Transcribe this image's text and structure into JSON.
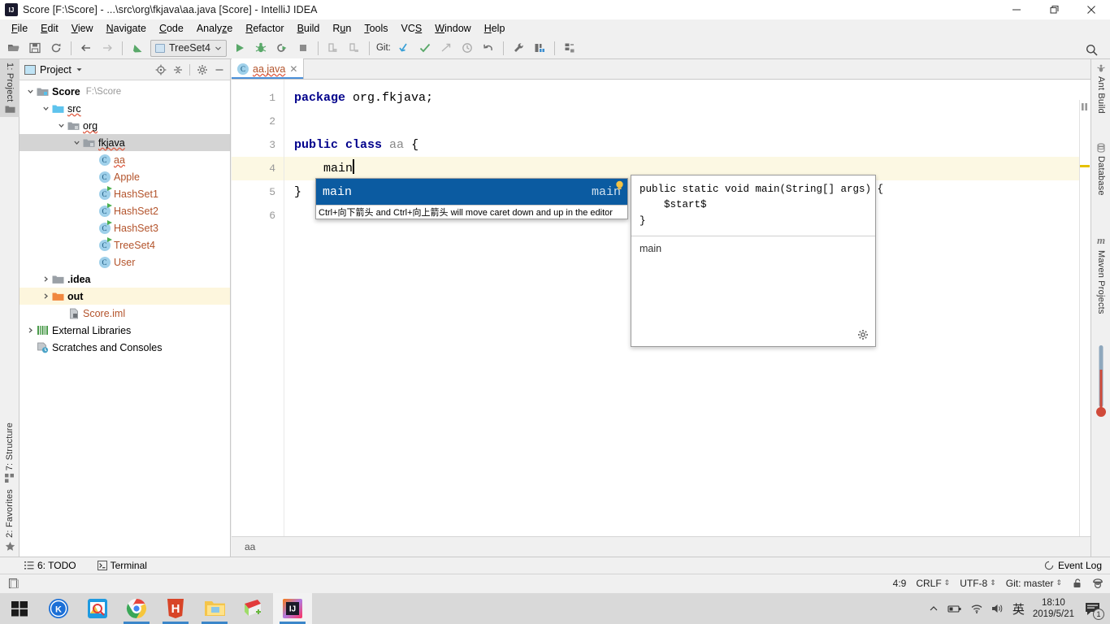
{
  "window": {
    "title": "Score [F:\\Score] - ...\\src\\org\\fkjava\\aa.java [Score] - IntelliJ IDEA",
    "app_icon": "intellij-idea-icon",
    "minimize": "—",
    "restore": "❐",
    "close": "✕"
  },
  "menubar": {
    "items": [
      {
        "label": "File"
      },
      {
        "label": "Edit"
      },
      {
        "label": "View"
      },
      {
        "label": "Navigate"
      },
      {
        "label": "Code"
      },
      {
        "label": "Analyze"
      },
      {
        "label": "Refactor"
      },
      {
        "label": "Build"
      },
      {
        "label": "Run"
      },
      {
        "label": "Tools"
      },
      {
        "label": "VCS"
      },
      {
        "label": "Window"
      },
      {
        "label": "Help"
      }
    ]
  },
  "toolbar": {
    "run_config": "TreeSet4",
    "git_label": "Git:",
    "icons": [
      "open-folder-icon",
      "save-all-icon",
      "sync-icon",
      "back-arrow-icon",
      "forward-arrow-icon",
      "compile-icon",
      "run-icon",
      "debug-icon",
      "run-coverage-icon",
      "stop-icon",
      "build-project-icon",
      "build-module-icon",
      "update-project-icon",
      "commit-icon",
      "push-icon",
      "history-icon",
      "undo-icon",
      "settings-wrench-icon",
      "structure-icon",
      "sdk-icon",
      "search-everywhere-icon"
    ]
  },
  "left_strip": {
    "top_buttons": [
      {
        "label": "1: Project",
        "icon": "project-folder-icon",
        "active": true
      }
    ],
    "bottom_buttons": [
      {
        "label": "7: Structure",
        "icon": "structure-icon"
      },
      {
        "label": "2: Favorites",
        "icon": "star-icon"
      }
    ]
  },
  "right_strip": {
    "buttons": [
      {
        "label": "Ant Build",
        "icon": "ant-icon"
      },
      {
        "label": "Database",
        "icon": "database-icon"
      },
      {
        "label": "Maven Projects",
        "icon": "maven-icon"
      }
    ]
  },
  "project_panel": {
    "title": "Project",
    "dropdown_icon": "chevron-down-icon",
    "header_icons": [
      "locate-icon",
      "collapse-all-icon",
      "gear-icon",
      "hide-icon"
    ],
    "tree": [
      {
        "depth": 0,
        "arrow": "down",
        "icon": "module-folder-icon",
        "label": "Score",
        "sub": "F:\\Score",
        "bold": true,
        "style": "plain",
        "row": "normal"
      },
      {
        "depth": 1,
        "arrow": "down",
        "icon": "source-folder-icon",
        "label": "src",
        "sub": "",
        "bold": false,
        "style": "wavy",
        "row": "normal"
      },
      {
        "depth": 2,
        "arrow": "down",
        "icon": "package-icon",
        "label": "org",
        "sub": "",
        "bold": false,
        "style": "wavy",
        "row": "normal"
      },
      {
        "depth": 3,
        "arrow": "down",
        "icon": "package-icon",
        "label": "fkjava",
        "sub": "",
        "bold": false,
        "style": "wavy",
        "row": "sel-gray"
      },
      {
        "depth": 4,
        "arrow": "none",
        "icon": "class-icon",
        "label": "aa",
        "sub": "",
        "bold": false,
        "style": "class-wavy",
        "row": "normal"
      },
      {
        "depth": 4,
        "arrow": "none",
        "icon": "class-icon",
        "label": "Apple",
        "sub": "",
        "bold": false,
        "style": "class",
        "row": "normal"
      },
      {
        "depth": 4,
        "arrow": "none",
        "icon": "runnable-class-icon",
        "label": "HashSet1",
        "sub": "",
        "bold": false,
        "style": "class",
        "row": "normal"
      },
      {
        "depth": 4,
        "arrow": "none",
        "icon": "runnable-class-icon",
        "label": "HashSet2",
        "sub": "",
        "bold": false,
        "style": "class",
        "row": "normal"
      },
      {
        "depth": 4,
        "arrow": "none",
        "icon": "runnable-class-icon",
        "label": "HashSet3",
        "sub": "",
        "bold": false,
        "style": "class",
        "row": "normal"
      },
      {
        "depth": 4,
        "arrow": "none",
        "icon": "runnable-class-icon",
        "label": "TreeSet4",
        "sub": "",
        "bold": false,
        "style": "class",
        "row": "normal"
      },
      {
        "depth": 4,
        "arrow": "none",
        "icon": "class-icon",
        "label": "User",
        "sub": "",
        "bold": false,
        "style": "class",
        "row": "normal"
      },
      {
        "depth": 1,
        "arrow": "right",
        "icon": "gray-folder-icon",
        "label": ".idea",
        "sub": "",
        "bold": true,
        "style": "plain",
        "row": "normal"
      },
      {
        "depth": 1,
        "arrow": "right",
        "icon": "excluded-folder-icon",
        "label": "out",
        "sub": "",
        "bold": true,
        "style": "plain",
        "row": "sel-yellow"
      },
      {
        "depth": 2,
        "arrow": "none",
        "icon": "iml-file-icon",
        "label": "Score.iml",
        "sub": "",
        "bold": false,
        "style": "class",
        "row": "normal"
      },
      {
        "depth": 0,
        "arrow": "right",
        "icon": "libraries-icon",
        "label": "External Libraries",
        "sub": "",
        "bold": false,
        "style": "plain",
        "row": "normal"
      },
      {
        "depth": 0,
        "arrow": "none",
        "icon": "scratches-icon",
        "label": "Scratches and Consoles",
        "sub": "",
        "bold": false,
        "style": "plain",
        "row": "normal"
      }
    ]
  },
  "editor": {
    "tab": {
      "label": "aa.java",
      "icon": "class-icon",
      "close": "✕"
    },
    "gutter_lines": [
      "1",
      "2",
      "3",
      "4",
      "5",
      "6"
    ],
    "highlight_line": 4,
    "lines": [
      {
        "n": 1,
        "tokens": [
          {
            "t": "package",
            "c": "kw"
          },
          {
            "t": " org.fkjava;",
            "c": "plain"
          }
        ]
      },
      {
        "n": 2,
        "tokens": []
      },
      {
        "n": 3,
        "tokens": [
          {
            "t": "public class",
            "c": "kw"
          },
          {
            "t": " ",
            "c": "plain"
          },
          {
            "t": "aa",
            "c": "dim"
          },
          {
            "t": " {",
            "c": "plain"
          }
        ]
      },
      {
        "n": 4,
        "tokens": [
          {
            "t": "    main",
            "c": "plain"
          }
        ]
      },
      {
        "n": 5,
        "tokens": [
          {
            "t": "}",
            "c": "plain"
          }
        ]
      },
      {
        "n": 6,
        "tokens": []
      }
    ],
    "breadcrumb": "aa"
  },
  "completion": {
    "item_label": "main",
    "item_type": "main",
    "bulb_icon": "lightbulb-icon",
    "hint": "Ctrl+向下箭头 and Ctrl+向上箭头 will move caret down and up in the editor"
  },
  "doc_popup": {
    "code": "public static void main(String[] args) {\n    $start$\n}",
    "description": "main",
    "gear_icon": "gear-icon"
  },
  "bottom_tool_strip": {
    "items": [
      {
        "label": "6: TODO",
        "icon": "todo-list-icon"
      },
      {
        "label": "Terminal",
        "icon": "terminal-icon"
      }
    ],
    "event_log": {
      "label": "Event Log",
      "icon": "event-log-icon"
    }
  },
  "statusbar": {
    "left_icon": "editor-layout-icon",
    "caret_position": "4:9",
    "line_separator": "CRLF",
    "encoding": "UTF-8",
    "branch": "Git: master",
    "lock_icon": "unlocked-icon",
    "inspection_icon": "inspection-hector-icon"
  },
  "taskbar": {
    "items": [
      {
        "name": "start-button",
        "icon": "windows-logo-icon",
        "open": false,
        "active": false
      },
      {
        "name": "kingsoft-button",
        "icon": "kingsoft-icon",
        "open": false,
        "active": false
      },
      {
        "name": "search-button",
        "icon": "search-photo-icon",
        "open": false,
        "active": false
      },
      {
        "name": "chrome-button",
        "icon": "chrome-icon",
        "open": true,
        "active": false
      },
      {
        "name": "hbuilder-button",
        "icon": "hbuilder-icon",
        "open": true,
        "active": false
      },
      {
        "name": "explorer-button",
        "icon": "file-explorer-icon",
        "open": true,
        "active": false
      },
      {
        "name": "notepadpp-button",
        "icon": "notepad-plus-plus-icon",
        "open": false,
        "active": false
      },
      {
        "name": "intellij-button",
        "icon": "intellij-idea-icon",
        "open": true,
        "active": true
      }
    ],
    "tray": {
      "chevron": "chevron-up-icon",
      "battery": "battery-icon",
      "wifi": "wifi-icon",
      "volume": "volume-icon",
      "ime": "英",
      "time": "18:10",
      "date": "2019/5/21",
      "notification_icon": "notification-icon",
      "notification_count": "1"
    }
  },
  "colors": {
    "accent_blue": "#0b5ba1",
    "highlight_yellow": "#fcf8e3",
    "class_orange": "#b3532b",
    "keyword_blue": "#00008b",
    "folder_blue": "#5ec3ed",
    "folder_orange": "#f0873f"
  }
}
